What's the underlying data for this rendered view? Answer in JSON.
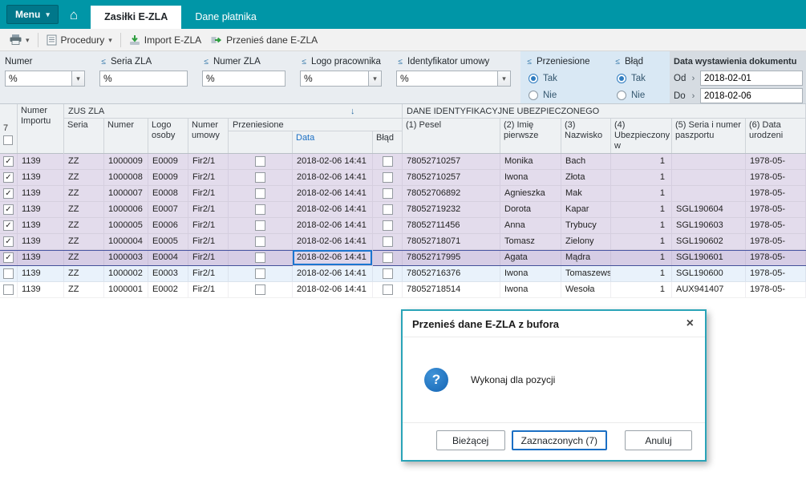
{
  "colors": {
    "topbar_teal": "#0096a7",
    "menu_button_teal": "#00778a",
    "accent_blue": "#1b6fc4",
    "icon_green": "#2e9e3f",
    "checked_row_bg": "#e3dcec",
    "current_row_bg": "#d6cde5",
    "hot_row_bg": "#e9f2fb",
    "dialog_border": "#2aa4b8"
  },
  "icons": {
    "caret_down": "▾",
    "home": "⌂",
    "filter": "≤",
    "sort_desc": "↓",
    "picker": "›",
    "close": "×",
    "check": "✓",
    "question": "?"
  },
  "topbar": {
    "menu_label": "Menu",
    "tabs": [
      {
        "label": "Zasiłki E-ZLA",
        "active": true
      },
      {
        "label": "Dane płatnika",
        "active": false
      }
    ]
  },
  "toolbar": {
    "procedury": "Procedury",
    "import": "Import E-ZLA",
    "przenies": "Przenieś dane E-ZLA"
  },
  "filters": {
    "numer": {
      "label": "Numer",
      "value": "%"
    },
    "seria_zla": {
      "label": "Seria ZLA",
      "value": "%"
    },
    "numer_zla": {
      "label": "Numer ZLA",
      "value": "%"
    },
    "logo_pracownika": {
      "label": "Logo pracownika",
      "value": "%"
    },
    "identyfikator_umowy": {
      "label": "Identyfikator umowy",
      "value": "%"
    },
    "przeniesione": {
      "label": "Przeniesione",
      "option_yes": "Tak",
      "option_no": "Nie",
      "selected": "Tak"
    },
    "blad": {
      "label": "Błąd",
      "option_yes": "Tak",
      "option_no": "Nie",
      "selected": "Tak"
    },
    "data_wystawienia": {
      "label": "Data wystawienia dokumentu",
      "od_label": "Od",
      "od_value": "2018-02-01",
      "do_label": "Do",
      "do_value": "2018-02-06"
    }
  },
  "table": {
    "selected_count": "7",
    "group_zus": "ZUS ZLA",
    "group_dane": "DANE IDENTYFIKACYJNE UBEZPIECZONEGO",
    "col_numer_importu": "Numer Importu",
    "col_seria": "Seria",
    "col_numer": "Numer",
    "col_logo": "Logo osoby",
    "col_umowa": "Numer umowy",
    "col_przeniesione": "Przeniesione",
    "col_data": "Data",
    "col_blad": "Błąd",
    "col_pesel": "(1) Pesel",
    "col_imie": "(2) Imię pierwsze",
    "col_nazwisko": "(3) Nazwisko",
    "col_ubezpieczony": "(4) Ubezpieczony w",
    "col_paszport": "(5) Seria i numer paszportu",
    "col_urodzony": "(6) Data urodzeni",
    "rows": [
      {
        "checked": true,
        "state": "checked",
        "numer_importu": "1139",
        "seria": "ZZ",
        "numer": "1000009",
        "logo": "E0009",
        "umowa": "Fir2/1",
        "data": "2018-02-06 14:41",
        "pesel": "78052710257",
        "imie": "Monika",
        "nazwisko": "Bach",
        "ubezpieczony": "1",
        "paszport": "",
        "urodzony": "1978-05-"
      },
      {
        "checked": true,
        "state": "checked",
        "numer_importu": "1139",
        "seria": "ZZ",
        "numer": "1000008",
        "logo": "E0009",
        "umowa": "Fir2/1",
        "data": "2018-02-06 14:41",
        "pesel": "78052710257",
        "imie": "Iwona",
        "nazwisko": "Złota",
        "ubezpieczony": "1",
        "paszport": "",
        "urodzony": "1978-05-"
      },
      {
        "checked": true,
        "state": "checked",
        "numer_importu": "1139",
        "seria": "ZZ",
        "numer": "1000007",
        "logo": "E0008",
        "umowa": "Fir2/1",
        "data": "2018-02-06 14:41",
        "pesel": "78052706892",
        "imie": "Agnieszka",
        "nazwisko": "Mak",
        "ubezpieczony": "1",
        "paszport": "",
        "urodzony": "1978-05-"
      },
      {
        "checked": true,
        "state": "checked",
        "numer_importu": "1139",
        "seria": "ZZ",
        "numer": "1000006",
        "logo": "E0007",
        "umowa": "Fir2/1",
        "data": "2018-02-06 14:41",
        "pesel": "78052719232",
        "imie": "Dorota",
        "nazwisko": "Kapar",
        "ubezpieczony": "1",
        "paszport": "SGL190604",
        "urodzony": "1978-05-"
      },
      {
        "checked": true,
        "state": "checked",
        "numer_importu": "1139",
        "seria": "ZZ",
        "numer": "1000005",
        "logo": "E0006",
        "umowa": "Fir2/1",
        "data": "2018-02-06 14:41",
        "pesel": "78052711456",
        "imie": "Anna",
        "nazwisko": "Trybucy",
        "ubezpieczony": "1",
        "paszport": "SGL190603",
        "urodzony": "1978-05-"
      },
      {
        "checked": true,
        "state": "checked",
        "numer_importu": "1139",
        "seria": "ZZ",
        "numer": "1000004",
        "logo": "E0005",
        "umowa": "Fir2/1",
        "data": "2018-02-06 14:41",
        "pesel": "78052718071",
        "imie": "Tomasz",
        "nazwisko": "Zielony",
        "ubezpieczony": "1",
        "paszport": "SGL190602",
        "urodzony": "1978-05-"
      },
      {
        "checked": true,
        "state": "checked current",
        "numer_importu": "1139",
        "seria": "ZZ",
        "numer": "1000003",
        "logo": "E0004",
        "umowa": "Fir2/1",
        "data": "2018-02-06 14:41",
        "pesel": "78052717995",
        "imie": "Agata",
        "nazwisko": "Mądra",
        "ubezpieczony": "1",
        "paszport": "SGL190601",
        "urodzony": "1978-05-"
      },
      {
        "checked": false,
        "state": "hot",
        "numer_importu": "1139",
        "seria": "ZZ",
        "numer": "1000002",
        "logo": "E0003",
        "umowa": "Fir2/1",
        "data": "2018-02-06 14:41",
        "pesel": "78052716376",
        "imie": "Iwona",
        "nazwisko": "Tomaszewska",
        "ubezpieczony": "1",
        "paszport": "SGL190600",
        "urodzony": "1978-05-"
      },
      {
        "checked": false,
        "state": "",
        "numer_importu": "1139",
        "seria": "ZZ",
        "numer": "1000001",
        "logo": "E0002",
        "umowa": "Fir2/1",
        "data": "2018-02-06 14:41",
        "pesel": "78052718514",
        "imie": "Iwona",
        "nazwisko": "Wesoła",
        "ubezpieczony": "1",
        "paszport": "AUX941407",
        "urodzony": "1978-05-"
      }
    ]
  },
  "dialog": {
    "title": "Przenieś dane E-ZLA z bufora",
    "message": "Wykonaj dla pozycji",
    "btn_current": "Bieżącej",
    "btn_selected": "Zaznaczonych (7)",
    "btn_cancel": "Anuluj"
  }
}
